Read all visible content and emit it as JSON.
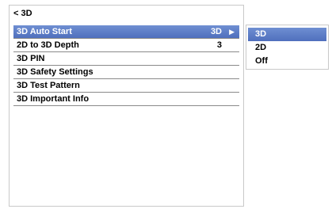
{
  "header": {
    "title": "< 3D"
  },
  "menu": {
    "items": [
      {
        "label": "3D Auto Start",
        "value": "3D",
        "arrow": "▶"
      },
      {
        "label": "2D to 3D Depth",
        "value": "3"
      },
      {
        "label": "3D PIN"
      },
      {
        "label": "3D Safety Settings"
      },
      {
        "label": "3D Test Pattern"
      },
      {
        "label": "3D Important Info"
      }
    ]
  },
  "submenu": {
    "options": [
      "3D",
      "2D",
      "Off"
    ],
    "selected": "3D"
  },
  "colors": {
    "highlight": "#5a7bc8",
    "divider": "#8a8a8a"
  }
}
